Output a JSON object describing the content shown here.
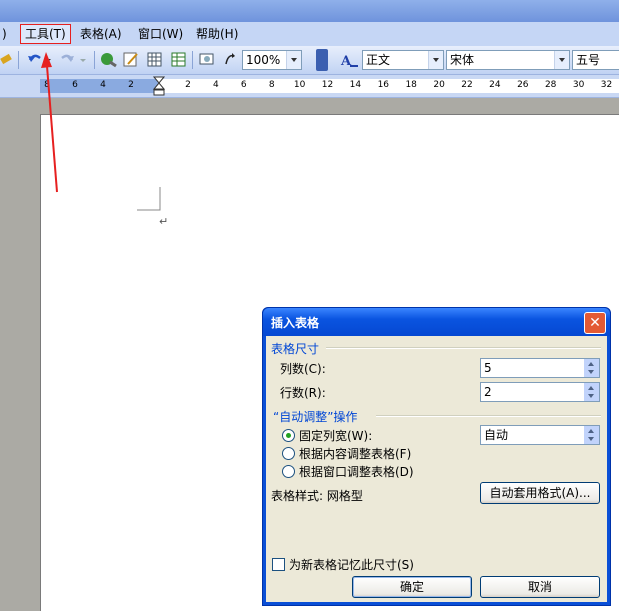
{
  "menu": {
    "partial_left": ")",
    "tools": "工具(T)",
    "table": "表格(A)",
    "window": "窗口(W)",
    "help": "帮助(H)"
  },
  "toolbar": {
    "zoom": "100%",
    "style": "正文",
    "font": "宋体",
    "size": "五号"
  },
  "ruler": {
    "left_numbers": [
      "8",
      "6",
      "4",
      "2"
    ],
    "right_numbers": [
      "2",
      "4",
      "6",
      "8",
      "10",
      "12",
      "14",
      "16",
      "18",
      "20",
      "22",
      "24",
      "26",
      "28",
      "30",
      "32"
    ]
  },
  "document": {
    "paragraph_mark": "↵"
  },
  "dialog": {
    "title": "插入表格",
    "close": "✕",
    "size_group": "表格尺寸",
    "columns_label": "列数(C):",
    "columns_value": "5",
    "rows_label": "行数(R):",
    "rows_value": "2",
    "autofit_group": "“自动调整”操作",
    "fixed_width_label": "固定列宽(W):",
    "fixed_width_value": "自动",
    "fit_content_label": "根据内容调整表格(F)",
    "fit_window_label": "根据窗口调整表格(D)",
    "style_label": "表格样式: 网格型",
    "autoformat_button": "自动套用格式(A)...",
    "remember_label": "为新表格记忆此尺寸(S)",
    "ok_button": "确定",
    "cancel_button": "取消"
  },
  "colors": {
    "annotation": "#e62020",
    "dialog_titlebar": "#0a54e0",
    "dialog_body": "#ece9d8"
  }
}
